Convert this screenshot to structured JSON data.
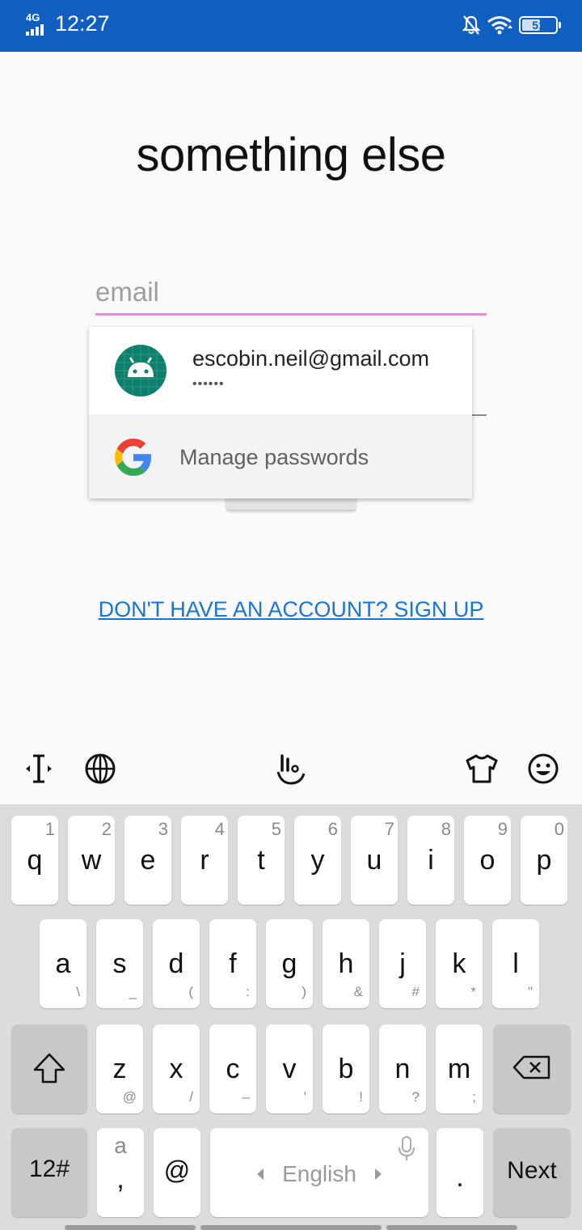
{
  "status_bar": {
    "network": "4G",
    "time": "12:27",
    "battery": "51"
  },
  "app": {
    "title": "something else",
    "email_placeholder": "email",
    "signup_link": "DON'T HAVE AN ACCOUNT? SIGN UP"
  },
  "autofill": {
    "account_email": "escobin.neil@gmail.com",
    "account_password": "••••••",
    "manage_label": "Manage passwords"
  },
  "keyboard": {
    "row1": [
      {
        "key": "q",
        "hint": "1"
      },
      {
        "key": "w",
        "hint": "2"
      },
      {
        "key": "e",
        "hint": "3"
      },
      {
        "key": "r",
        "hint": "4"
      },
      {
        "key": "t",
        "hint": "5"
      },
      {
        "key": "y",
        "hint": "6"
      },
      {
        "key": "u",
        "hint": "7"
      },
      {
        "key": "i",
        "hint": "8"
      },
      {
        "key": "o",
        "hint": "9"
      },
      {
        "key": "p",
        "hint": "0"
      }
    ],
    "row2": [
      {
        "key": "a",
        "hint": "\\"
      },
      {
        "key": "s",
        "hint": "_"
      },
      {
        "key": "d",
        "hint": "("
      },
      {
        "key": "f",
        "hint": ":"
      },
      {
        "key": "g",
        "hint": ")"
      },
      {
        "key": "h",
        "hint": "&"
      },
      {
        "key": "j",
        "hint": "#"
      },
      {
        "key": "k",
        "hint": "*"
      },
      {
        "key": "l",
        "hint": "\""
      }
    ],
    "row3": [
      {
        "key": "z",
        "hint": "@"
      },
      {
        "key": "x",
        "hint": "/"
      },
      {
        "key": "c",
        "hint": "–"
      },
      {
        "key": "v",
        "hint": "'"
      },
      {
        "key": "b",
        "hint": "!"
      },
      {
        "key": "n",
        "hint": "?"
      },
      {
        "key": "m",
        "hint": ";"
      }
    ],
    "symbols_label": "12#",
    "comma_top": "a",
    "comma_label": ",",
    "at_label": "@",
    "space_label": "English",
    "period_label": ".",
    "next_label": "Next"
  }
}
